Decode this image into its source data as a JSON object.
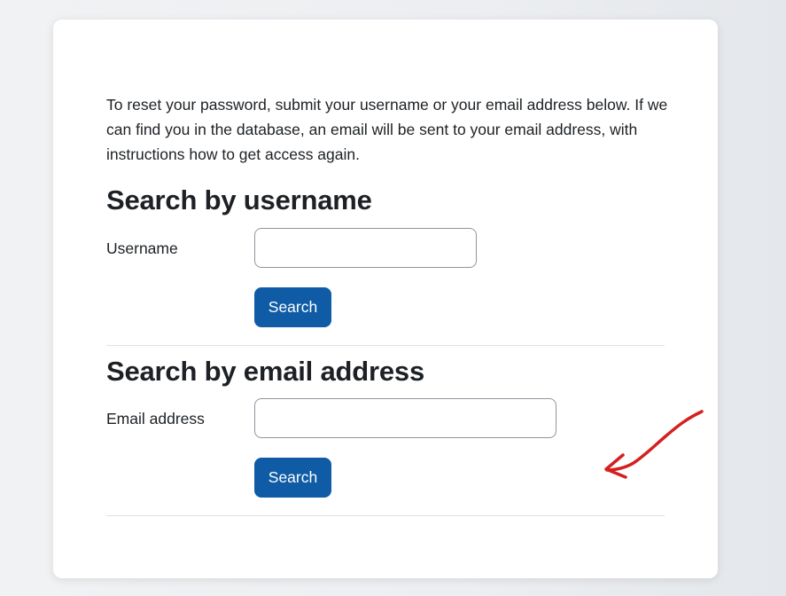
{
  "intro_text": "To reset your password, submit your username or your email address below. If we can find you in the database, an email will be sent to your email address, with instructions how to get access again.",
  "username_section": {
    "heading": "Search by username",
    "label": "Username",
    "value": "",
    "button_label": "Search"
  },
  "email_section": {
    "heading": "Search by email address",
    "label": "Email address",
    "value": "",
    "button_label": "Search"
  },
  "colors": {
    "button": "#0f5ba6",
    "annotation_arrow": "#d42020"
  }
}
